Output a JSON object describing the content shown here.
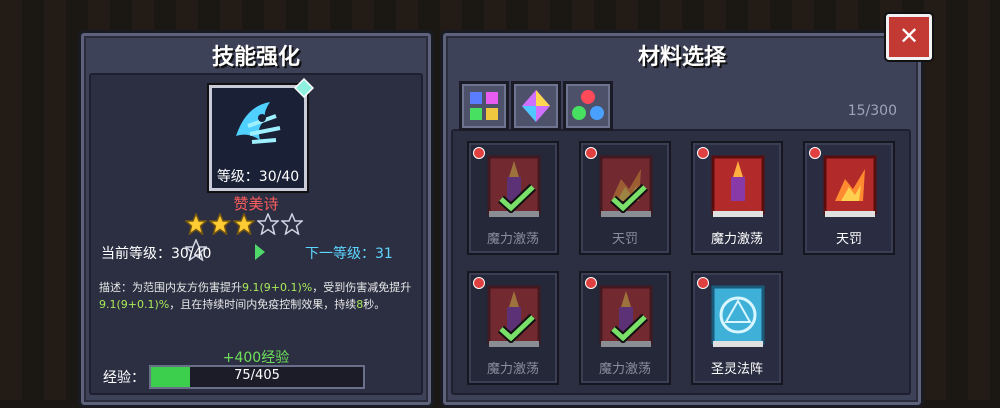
{
  "left": {
    "title": "技能强化",
    "skill_level": "等级：30/40",
    "skill_name": "赞美诗",
    "stars_filled": 3,
    "stars_total": 6,
    "current_level": "当前等级：30/40",
    "next_level": "下一等级：31",
    "desc_parts": [
      "描述：为范围内友方伤害提升",
      "9.1(9+0.1)%",
      "，受到伤害减免提升",
      "9.1(9+0.1)%",
      "，且在持续时间内免疫控制效果，持续",
      "8",
      "秒。"
    ],
    "xp_gain": "+400经验",
    "xp_label": "经验：",
    "xp_text": "75/405",
    "xp_fraction": 0.185
  },
  "right": {
    "title": "材料选择",
    "count": "15/300",
    "tabs": [
      "grid-tab-icon",
      "gem-tab-icon",
      "orbs-tab-icon"
    ],
    "cards": [
      {
        "name": "魔力激荡",
        "state": "used"
      },
      {
        "name": "天罚",
        "state": "used"
      },
      {
        "name": "魔力激荡",
        "state": "available"
      },
      {
        "name": "天罚",
        "state": "available"
      },
      {
        "name": "魔力激荡",
        "state": "used"
      },
      {
        "name": "魔力激荡",
        "state": "used"
      },
      {
        "name": "圣灵法阵",
        "state": "available"
      }
    ]
  },
  "close_label": "✕",
  "colors": {
    "red_text": "#ff5d5d",
    "next_level": "#5fd6ff",
    "xp_green": "#3ccf4e",
    "highlight": "#a8e85a"
  }
}
